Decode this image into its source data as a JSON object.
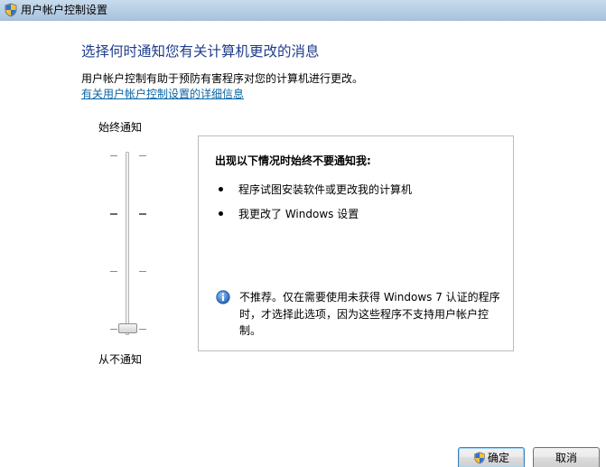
{
  "window": {
    "title": "用户帐户控制设置"
  },
  "main": {
    "heading": "选择何时通知您有关计算机更改的消息",
    "description": "用户帐户控制有助于预防有害程序对您的计算机进行更改。",
    "more_info_link": "有关用户帐户控制设置的详细信息"
  },
  "slider": {
    "top_label": "始终通知",
    "bottom_label": "从不通知",
    "levels": 4,
    "selected_level": 1
  },
  "panel": {
    "heading": "出现以下情况时始终不要通知我:",
    "bullets": [
      "程序试图安装软件或更改我的计算机",
      "我更改了 Windows 设置"
    ],
    "note": "不推荐。仅在需要使用未获得 Windows 7 认证的程序时，才选择此选项，因为这些程序不支持用户帐户控制。"
  },
  "buttons": {
    "ok_label": "确定",
    "cancel_label": "取消"
  },
  "colors": {
    "heading": "#1e3c8c",
    "link": "#0a64a4",
    "titlebar": "#b6cde4"
  },
  "icons": {
    "title": "uac-shield-icon",
    "note": "info-icon",
    "ok_button": "uac-shield-icon"
  }
}
